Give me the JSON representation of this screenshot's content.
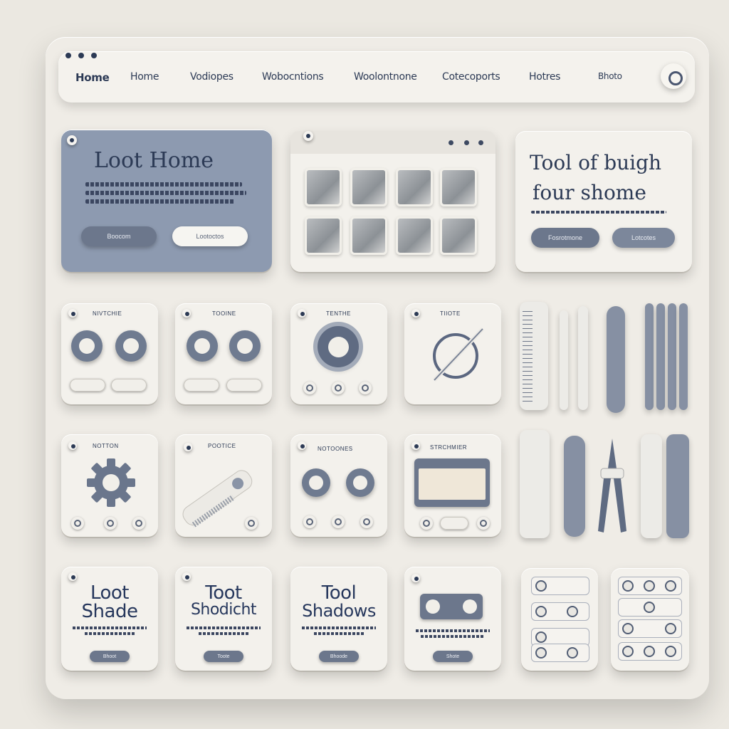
{
  "nav": {
    "brand": "Home",
    "items": [
      "Home",
      "Vodiopes",
      "Wobocntions",
      "Woolontnone",
      "Cotecoports",
      "Hotres"
    ],
    "right_label": "Bhoto"
  },
  "hero": {
    "title": "Loot Home",
    "primary_button": "Boocom",
    "secondary_button": "Lootoctos"
  },
  "promo": {
    "title_line1": "Tool of buigh",
    "title_line2": "four shome",
    "primary_button": "Fosrotmone",
    "secondary_button": "Lotcotes"
  },
  "row1": {
    "tiles": [
      {
        "label": "NIVTCHIE"
      },
      {
        "label": "TOOINE"
      },
      {
        "label": "TENTHE"
      },
      {
        "label": "TIIOTE"
      }
    ]
  },
  "row2": {
    "tiles": [
      {
        "label": "NOTTON"
      },
      {
        "label": "POOTICE"
      },
      {
        "label": "NOTOONES"
      },
      {
        "label": "STRCHMIER"
      }
    ]
  },
  "row3": {
    "cards": [
      {
        "title_line1": "Loot",
        "title_line2": "Shade",
        "button": "Bhoot"
      },
      {
        "title_line1": "Toot",
        "title_line2": "Shodicht",
        "button": "Toote"
      },
      {
        "title_line1": "Tool",
        "title_line2": "Shadows",
        "button": "Bhoode"
      },
      {
        "button": "Shote"
      }
    ]
  },
  "colors": {
    "accent_slate": "#6c778c",
    "hero_blue": "#8d9ab0",
    "ink": "#2c3a55",
    "board": "#efece6"
  },
  "icons": [
    "gear-icon",
    "comb-icon",
    "compass-icon",
    "pliers-icon",
    "ruler-icon",
    "screwdriver-icon",
    "wrench-icon"
  ]
}
